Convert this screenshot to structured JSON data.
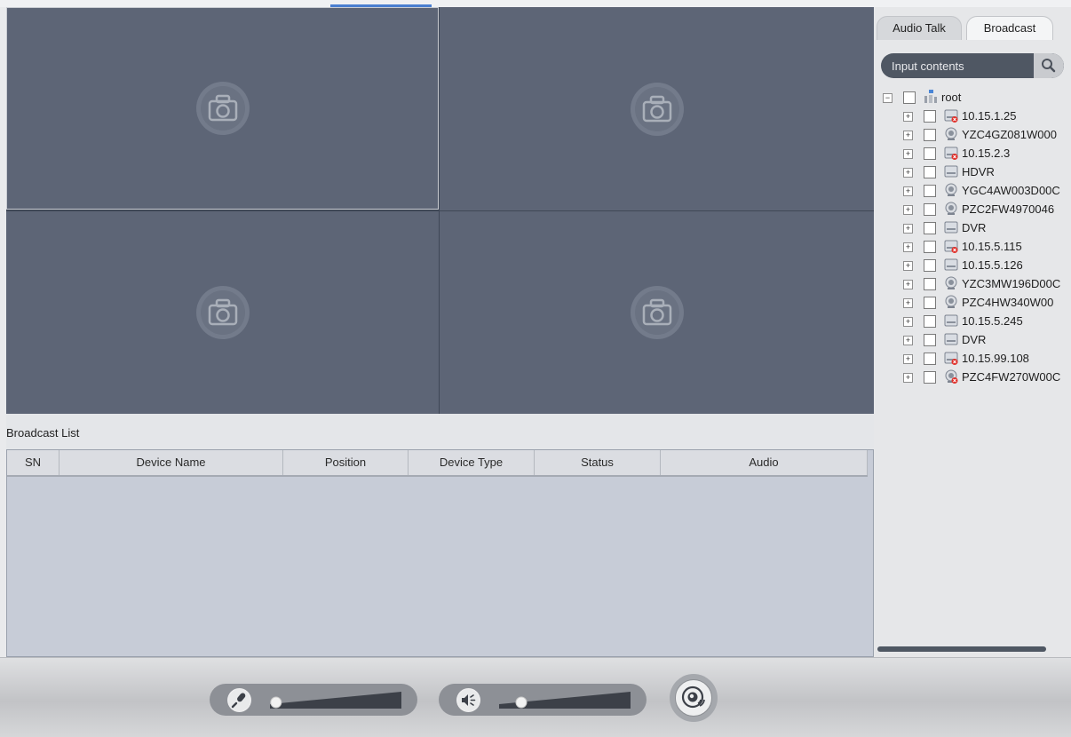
{
  "sidebar": {
    "tabs": [
      {
        "label": "Audio Talk"
      },
      {
        "label": "Broadcast"
      }
    ],
    "search": {
      "placeholder": "Input contents"
    },
    "tree": {
      "root": "root",
      "devices": [
        {
          "label": "10.15.1.25",
          "icon": "dvr-offline-icon"
        },
        {
          "label": "YZC4GZ081W000",
          "icon": "ip-camera-icon"
        },
        {
          "label": "10.15.2.3",
          "icon": "dvr-offline-icon"
        },
        {
          "label": "HDVR",
          "icon": "dvr-icon"
        },
        {
          "label": "YGC4AW003D00C",
          "icon": "ip-camera-icon"
        },
        {
          "label": "PZC2FW4970046",
          "icon": "ip-camera-icon"
        },
        {
          "label": "DVR",
          "icon": "dvr-icon"
        },
        {
          "label": "10.15.5.115",
          "icon": "dvr-offline-icon"
        },
        {
          "label": "10.15.5.126",
          "icon": "dvr-icon"
        },
        {
          "label": "YZC3MW196D00C",
          "icon": "ip-camera-icon"
        },
        {
          "label": "PZC4HW340W00",
          "icon": "ip-camera-icon"
        },
        {
          "label": "10.15.5.245",
          "icon": "dvr-icon"
        },
        {
          "label": "DVR",
          "icon": "dvr-icon"
        },
        {
          "label": "10.15.99.108",
          "icon": "dvr-offline-icon"
        },
        {
          "label": "PZC4FW270W00C",
          "icon": "ip-camera-offline-icon"
        }
      ]
    }
  },
  "broadcast_list": {
    "title": "Broadcast List",
    "columns": [
      "SN",
      "Device Name",
      "Position",
      "Device Type",
      "Status",
      "Audio"
    ]
  },
  "controls": {
    "microphone_level": 0.02,
    "speaker_level": 0.15
  },
  "colors": {
    "pane": "#5d6576",
    "accent": "#4a7fd0",
    "table_bg": "#c7ccd7"
  }
}
